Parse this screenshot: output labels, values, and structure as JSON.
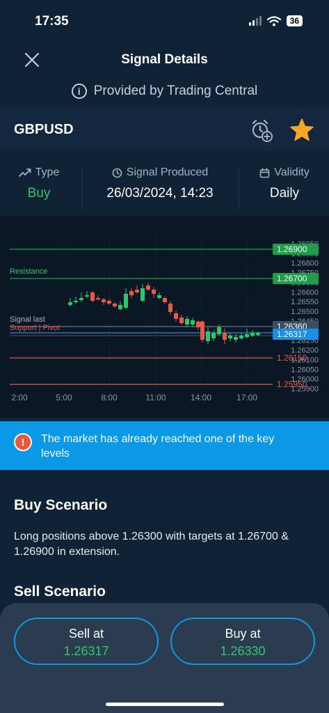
{
  "status_bar": {
    "time": "17:35",
    "battery": "36"
  },
  "header": {
    "title": "Signal Details",
    "provider": "Provided by Trading Central"
  },
  "symbol": "GBPUSD",
  "info": {
    "type_label": "Type",
    "type_value": "Buy",
    "produced_label": "Signal Produced",
    "produced_value": "26/03/2024, 14:23",
    "validity_label": "Validity",
    "validity_value": "Daily"
  },
  "chart": {
    "resistance_label": "Resistance",
    "signal_last_label": "Signal last",
    "support_pivot_label": "Support | Pivot",
    "price_axis": [
      "1.26950",
      "1.26850",
      "1.26800",
      "1.26750",
      "1.26650",
      "1.26600",
      "1.26550",
      "1.26500",
      "1.26450",
      "1.26400",
      "1.26250",
      "1.26200",
      "1.26100",
      "1.26050",
      "1.26000",
      "1.25900"
    ],
    "time_axis": [
      "2:00",
      "5:00",
      "8:00",
      "11:00",
      "14:00",
      "17:00"
    ],
    "level_tags": [
      {
        "value": "1.26900",
        "color": "#1f9e4a"
      },
      {
        "value": "1.26700",
        "color": "#1f9e4a"
      },
      {
        "value": "1.26360",
        "color": "#3a4e63"
      },
      {
        "value": "1.26317",
        "color": "#1a8fe3"
      },
      {
        "value": "1.26150",
        "color": "transparent",
        "text_color": "#e8594a"
      },
      {
        "value": "1.25950",
        "color": "transparent",
        "text_color": "#e8594a"
      }
    ]
  },
  "alert": {
    "text": "The market has already reached one of the key levels"
  },
  "buy_scenario": {
    "title": "Buy Scenario",
    "text": "Long positions above 1.26300 with targets at 1.26700 & 1.26900 in extension."
  },
  "sell_scenario": {
    "title": "Sell Scenario"
  },
  "actions": {
    "sell_label": "Sell at",
    "sell_price": "1.26317",
    "buy_label": "Buy at",
    "buy_price": "1.26330"
  },
  "colors": {
    "buy_green": "#2ec76b",
    "accent_blue": "#0a99e6",
    "star": "#f5a623"
  }
}
